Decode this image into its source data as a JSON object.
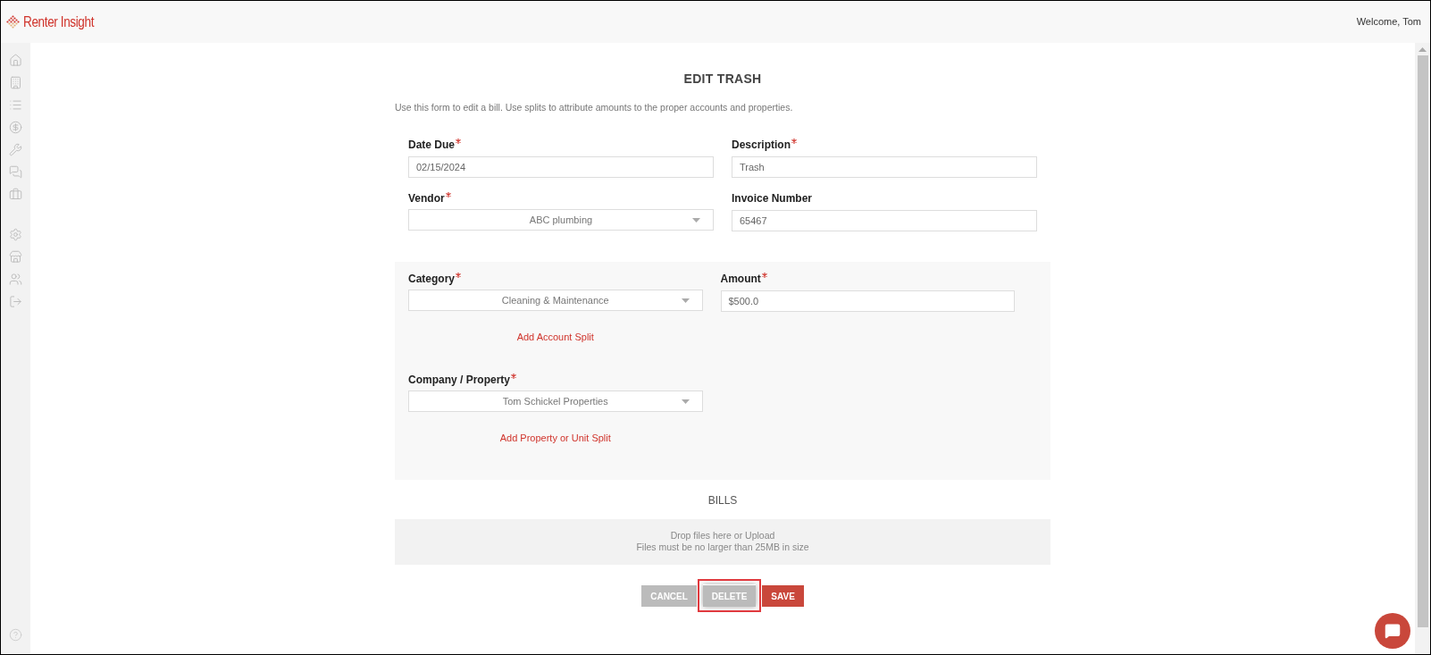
{
  "header": {
    "brand": "Renter Insight",
    "welcome": "Welcome, Tom"
  },
  "form": {
    "title": "EDIT TRASH",
    "intro": "Use this form to edit a bill. Use splits to attribute amounts to the proper accounts and properties.",
    "fields": [
      {
        "label": "Date Due",
        "required": true,
        "kind": "text",
        "value": "02/15/2024"
      },
      {
        "label": "Description",
        "required": true,
        "kind": "text",
        "value": "Trash"
      },
      {
        "label": "Vendor",
        "required": true,
        "kind": "select",
        "value": "ABC plumbing"
      },
      {
        "label": "Invoice Number",
        "required": false,
        "kind": "text",
        "value": "65467"
      }
    ],
    "splits": {
      "category": {
        "label": "Category",
        "required": true,
        "kind": "select",
        "value": "Cleaning & Maintenance"
      },
      "amount": {
        "label": "Amount",
        "required": true,
        "kind": "text",
        "value": "$500.0"
      },
      "account_split_link": "Add Account Split",
      "property": {
        "label": "Company / Property",
        "required": true,
        "kind": "select",
        "value": "Tom Schickel Properties"
      },
      "property_split_link": "Add Property or Unit Split"
    },
    "bills": {
      "heading": "BILLS",
      "drop_text": "Drop files here or Upload",
      "limit_text": "Files must be no larger than 25MB in size"
    },
    "buttons": [
      {
        "label": "CANCEL",
        "kind": "neutral",
        "highlighted": false
      },
      {
        "label": "DELETE",
        "kind": "neutral",
        "highlighted": true
      },
      {
        "label": "SAVE",
        "kind": "primary",
        "highlighted": false
      }
    ]
  }
}
